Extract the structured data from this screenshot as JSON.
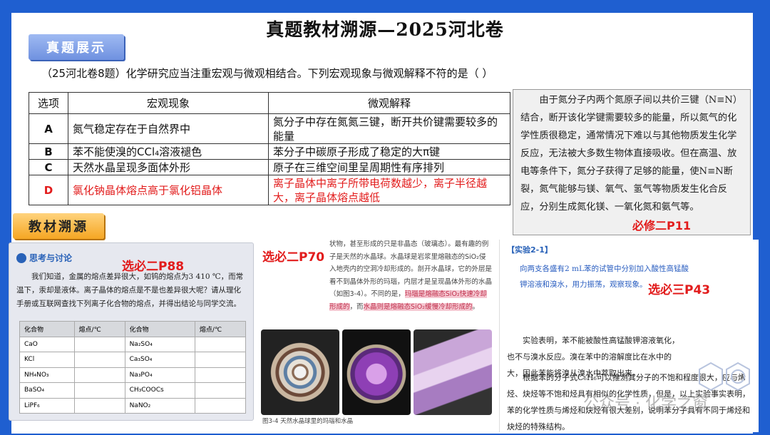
{
  "title": "真题教材溯源—2025河北卷",
  "tag_exam": "真题展示",
  "tag_source": "教材溯源",
  "question": "（25河北卷8题）化学研究应当注重宏观与微观相结合。下列宏观现象与微观解释不符的是（    ）",
  "table": {
    "headers": [
      "选项",
      "宏观现象",
      "微观解释"
    ],
    "rows": [
      {
        "opt": "A",
        "macro": "氮气稳定存在于自然界中",
        "micro": "氮分子中存在氮氮三键，断开共价键需要较多的能量"
      },
      {
        "opt": "B",
        "macro": "苯不能使溴的CCl₄溶液褪色",
        "micro": "苯分子中碳原子形成了稳定的大π键"
      },
      {
        "opt": "C",
        "macro": "天然水晶呈现多面体外形",
        "micro": "原子在三维空间里呈周期性有序排列"
      },
      {
        "opt": "D",
        "macro": "氯化钠晶体熔点高于氯化铝晶体",
        "micro": "离子晶体中离子所带电荷数越少，离子半径越大，离子晶体熔点越低"
      }
    ]
  },
  "textbook_excerpt": "由于氮分子内两个氮原子间以共价三键（N≡N）结合，断开该化学键需要较多的能量，所以氮气的化学性质很稳定，通常情况下难以与其他物质发生化学反应，无法被大多数生物体直接吸收。但在高温、放电等条件下，氮分子获得了足够的能量，使N≡N断裂，氮气能够与镁、氧气、氢气等物质发生化合反应，分别生成氮化镁、一氧化氮和氨气等。",
  "ref_bixiu2": "必修二P11",
  "ref_xuanbi2_p88": "选必二P88",
  "ref_xuanbi2_p70": "选必二P70",
  "ref_xuanbi3_p43": "选必三P43",
  "p88": {
    "header": "思考与讨论",
    "body": "我们知道，金属的熔点差异很大，如钨的熔点为3 410 ℃，而常温下，汞却是液体。离子晶体的熔点是不是也差异很大呢？请从理化手册或互联网查找下列离子化合物的熔点，并得出结论与同学交流。",
    "table_headers": [
      "化合物",
      "熔点/℃",
      "化合物",
      "熔点/℃"
    ],
    "table_rows": [
      [
        "CaO",
        "",
        "Na₂SO₄",
        ""
      ],
      [
        "KCl",
        "",
        "Ca₃SO₄",
        ""
      ],
      [
        "NH₄NO₃",
        "",
        "Na₃PO₄",
        ""
      ],
      [
        "BaSO₄",
        "",
        "CH₃COOCs",
        ""
      ],
      [
        "LiPF₆",
        "",
        "NaNO₂",
        ""
      ]
    ]
  },
  "p70": {
    "text_a": "状物，甚至形成的只是非晶态（玻璃态）。最有趣的例子是天然的水晶球。水晶球是岩浆里熔融态的SiO₂侵入地壳内的空洞冷却形成的。剖开水晶球，它的外层是看不到晶体外形的玛瑙，内层才是呈现晶体外形的水晶（如图3-4）。不同的是，",
    "text_hl_1": "玛瑙是熔融态SiO₂快速冷却形成的",
    "text_b": "，而",
    "text_hl_2": "水晶则是熔融态SiO₂缓慢冷却形成的",
    "text_c": "。",
    "caption": "图3-4  天然水晶球里的玛瑙和水晶"
  },
  "p43": {
    "experiment": "【实验2-1】",
    "instruction": "向两支各盛有2 mL苯的试管中分别加入酸性高锰酸钾溶液和溴水，用力振荡，观察现象。",
    "conclusion_1": "实验表明，苯不能被酸性高锰酸钾溶液氧化，也不与溴水反应。溴在苯中的溶解度比在水中的大，因此苯能将溴从溴水中萃取出来。",
    "conclusion_2": "根据苯的分子式C₆H₆可以推测其分子的不饱和程度很大，应与烯烃、炔烃等不饱和烃具有相似的化学性质，但是，以上实验事实表明，苯的化学性质与烯烃和炔烃有很大差别，说明苯分子具有不同于烯烃和炔烃的特殊结构。"
  },
  "watermark": "公众号 · 化学之窗",
  "colors": {
    "accent_red": "#e21c1c",
    "frame_blue": "#1f5fd0",
    "tag_orange": "#f5a623"
  }
}
